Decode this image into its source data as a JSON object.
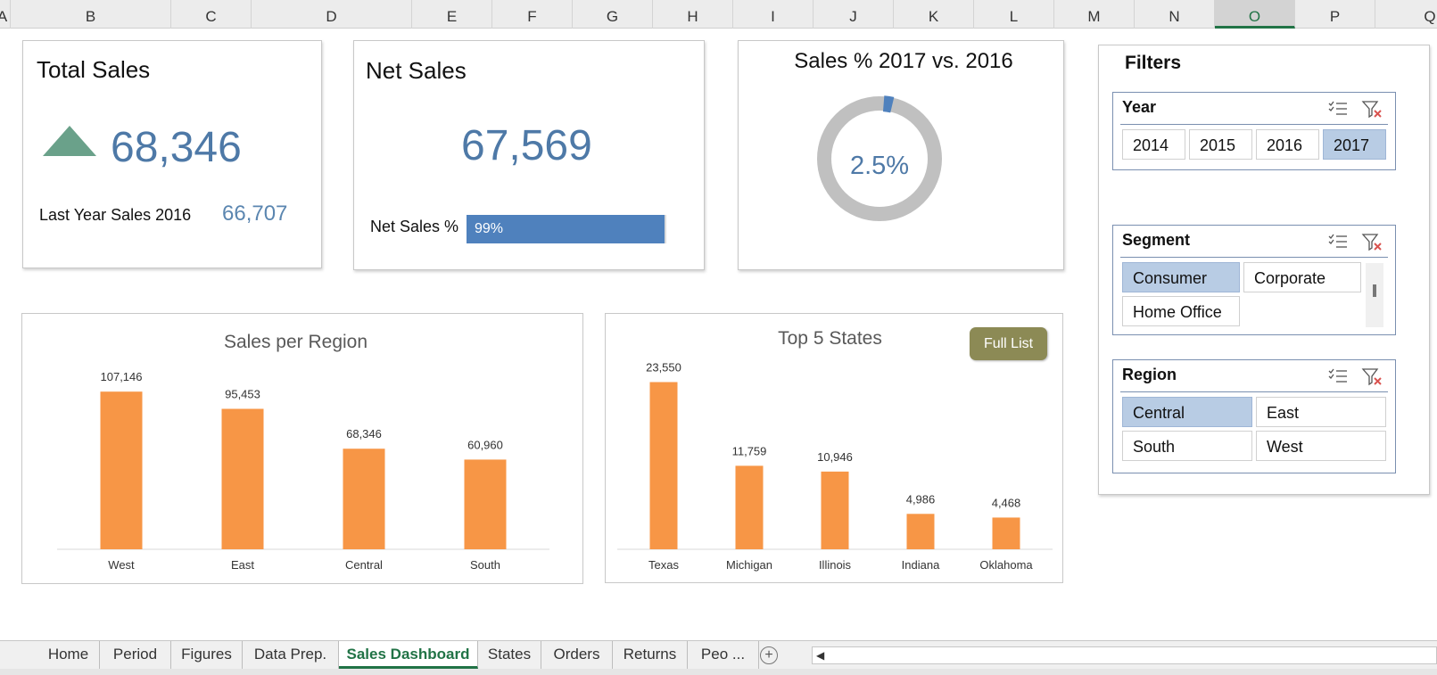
{
  "columns": [
    "A",
    "B",
    "C",
    "D",
    "E",
    "F",
    "G",
    "H",
    "I",
    "J",
    "K",
    "L",
    "M",
    "N",
    "O",
    "P",
    "Q"
  ],
  "selected_column": "O",
  "total_sales": {
    "title": "Total Sales",
    "value": "68,346",
    "trend_icon": "up-triangle-icon",
    "last_year_label": "Last Year Sales 2016",
    "last_year_value": "66,707"
  },
  "net_sales": {
    "title": "Net Sales",
    "value": "67,569",
    "pct_label": "Net Sales %",
    "pct_text": "99%",
    "pct_fraction": 0.99
  },
  "sales_pct": {
    "title": "Sales % 2017 vs. 2016",
    "value": "2.5%",
    "fraction": 0.025
  },
  "filters": {
    "title": "Filters",
    "year": {
      "title": "Year",
      "items": [
        "2014",
        "2015",
        "2016",
        "2017"
      ],
      "selected": [
        "2017"
      ]
    },
    "segment": {
      "title": "Segment",
      "items": [
        "Consumer",
        "Corporate",
        "Home Office"
      ],
      "selected": [
        "Consumer"
      ]
    },
    "region": {
      "title": "Region",
      "items": [
        "Central",
        "East",
        "South",
        "West"
      ],
      "selected": [
        "Central"
      ]
    }
  },
  "full_list_button": "Full List",
  "chart_data": [
    {
      "type": "bar",
      "title": "Sales per Region",
      "categories": [
        "West",
        "East",
        "Central",
        "South"
      ],
      "values": [
        107146,
        95453,
        68346,
        60960
      ],
      "labels": [
        "107,146",
        "95,453",
        "68,346",
        "60,960"
      ],
      "ylim": [
        0,
        120000
      ],
      "color": "#f79646",
      "grid": false
    },
    {
      "type": "bar",
      "title": "Top 5 States",
      "categories": [
        "Texas",
        "Michigan",
        "Illinois",
        "Indiana",
        "Oklahoma"
      ],
      "values": [
        23550,
        11759,
        10946,
        4986,
        4468
      ],
      "labels": [
        "23,550",
        "11,759",
        "10,946",
        "4,986",
        "4,468"
      ],
      "ylim": [
        0,
        26000
      ],
      "color": "#f79646",
      "grid": false
    }
  ],
  "sheet_tabs": [
    "Home",
    "Period",
    "Figures",
    "Data Prep.",
    "Sales Dashboard",
    "States",
    "Orders",
    "Returns",
    "Peo ..."
  ],
  "active_tab": "Sales Dashboard",
  "colors": {
    "accent_blue": "#4e79a7",
    "bar_orange": "#f79646",
    "excel_green": "#217346",
    "slicer_selected": "#b8cce4",
    "button_olive": "#8c8a55"
  }
}
